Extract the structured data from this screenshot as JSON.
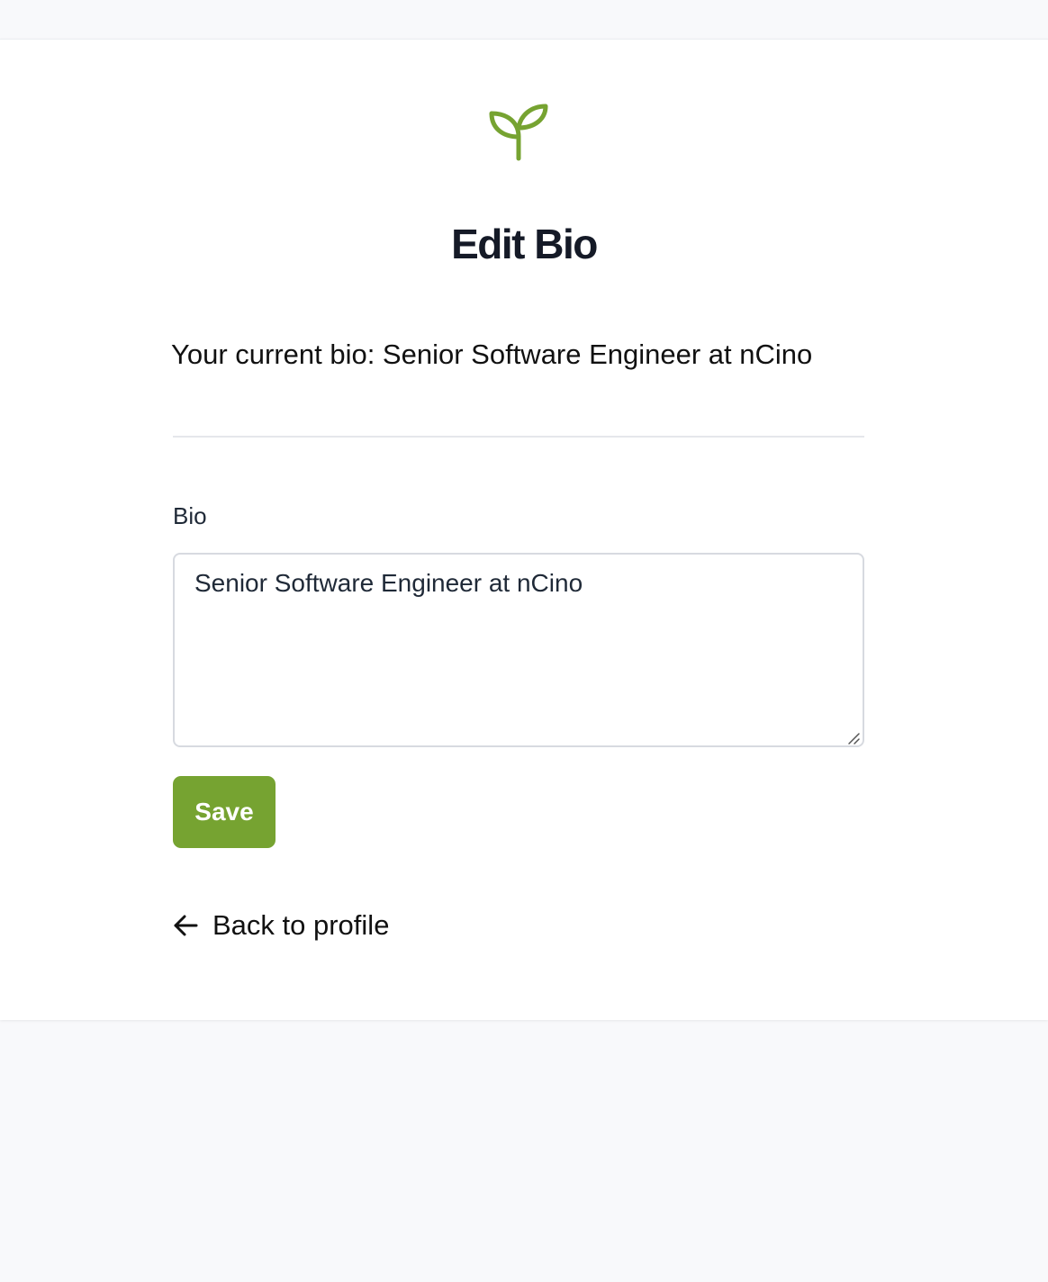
{
  "header": {
    "logo_icon": "sprout-icon",
    "brand_color": "#76a331",
    "title": "Edit Bio"
  },
  "current_bio": {
    "text": "Your current bio: Senior Software Engineer at nCino"
  },
  "form": {
    "bio_label": "Bio",
    "bio_value": "Senior Software Engineer at nCino",
    "save_label": "Save"
  },
  "nav": {
    "back_icon": "arrow-left-icon",
    "back_label": "Back to profile"
  }
}
